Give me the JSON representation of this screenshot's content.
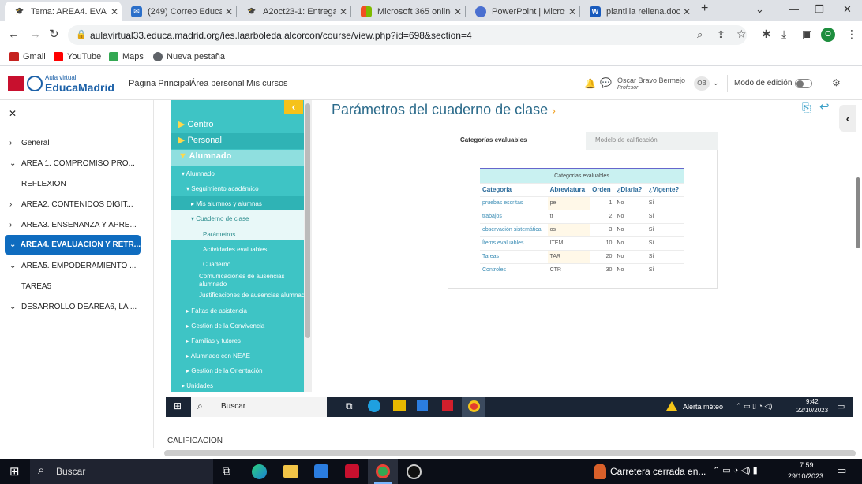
{
  "browser": {
    "tabs": [
      {
        "title": "Tema: AREA4. EVALU",
        "icon": "mortarboard-icon",
        "color": "#1a56b0",
        "active": true
      },
      {
        "title": "(249) Correo EducaM",
        "icon": "mail-icon",
        "color": "#2b6fc9"
      },
      {
        "title": "A2oct23-1: Entrega T",
        "icon": "mortarboard-icon",
        "color": "#1a56b0"
      },
      {
        "title": "Microsoft 365 online",
        "icon": "microsoft-icon",
        "color": "#f25022"
      },
      {
        "title": "PowerPoint | Microso",
        "icon": "onedrive-icon",
        "color": "#4a6fd0"
      },
      {
        "title": "plantilla rellena.docx",
        "icon": "word-icon",
        "color": "#185abd"
      }
    ],
    "url": "aulavirtual33.educa.madrid.org/ies.laarboleda.alcorcon/course/view.php?id=698&section=4",
    "profile_initial": "O",
    "bookmarks": [
      {
        "label": "Gmail",
        "color": "#c5221f"
      },
      {
        "label": "YouTube",
        "color": "#ff0000"
      },
      {
        "label": "Maps",
        "color": "#34a853"
      },
      {
        "label": "Nueva pestaña",
        "color": "#5f6368"
      }
    ]
  },
  "site": {
    "logo_small": "Aula virtual",
    "logo_big": "EducaMadrid",
    "nav": [
      "Página Principal",
      "Área personal",
      "Mis cursos"
    ],
    "user_name": "Oscar Bravo Bermejo",
    "user_role": "Profesor",
    "user_initials": "OB",
    "edit_mode_label": "Modo de edición"
  },
  "drawer": {
    "items": [
      {
        "label": "General",
        "chevron": "›"
      },
      {
        "label": "AREA 1. COMPROMISO PRO...",
        "chevron": "⌄"
      },
      {
        "label": "REFLEXION",
        "chevron": ""
      },
      {
        "label": "AREA2. CONTENIDOS DIGIT...",
        "chevron": "›"
      },
      {
        "label": "AREA3. ENSENANZA Y APRE...",
        "chevron": "›"
      },
      {
        "label": "AREA4. EVALUACION Y RETR...",
        "chevron": "⌄",
        "active": true
      },
      {
        "label": "AREA5. EMPODERAMIENTO ...",
        "chevron": "⌄"
      },
      {
        "label": "TAREA5",
        "chevron": ""
      },
      {
        "label": "DESARROLLO DEAREA6, LA ...",
        "chevron": "⌄"
      }
    ]
  },
  "inner": {
    "menu": [
      {
        "label": "Centro",
        "big": true
      },
      {
        "label": "Personal",
        "big": true
      },
      {
        "label": "Alumnado",
        "big": true
      },
      {
        "label": "Alumnado"
      },
      {
        "label": "Seguimiento académico"
      },
      {
        "label": "Mis alumnos y alumnas"
      },
      {
        "label": "Cuaderno de clase"
      },
      {
        "label": "Parámetros"
      },
      {
        "label": "Actividades evaluables"
      },
      {
        "label": "Cuaderno"
      },
      {
        "label": "Comunicaciones de ausencias"
      },
      {
        "label": "alumnado"
      },
      {
        "label": "Justificaciones de ausencias alumnado"
      },
      {
        "label": "Faltas de asistencia"
      },
      {
        "label": "Gestión de la Convivencia"
      },
      {
        "label": "Familias y tutores"
      },
      {
        "label": "Alumnado con NEAE"
      },
      {
        "label": "Gestión de la Orientación"
      },
      {
        "label": "Unidades"
      }
    ],
    "page_title": "Parámetros del cuaderno de clase",
    "tabs": [
      "Categorías evaluables",
      "Modelo de calificación"
    ],
    "table_caption": "Categorías evaluables",
    "columns": [
      "Categoría",
      "Abreviatura",
      "Orden",
      "¿Diaria?",
      "¿Vigente?"
    ],
    "rows": [
      [
        "pruebas escritas",
        "pe",
        "1",
        "No",
        "Sí"
      ],
      [
        "trabajos",
        "tr",
        "2",
        "No",
        "Sí"
      ],
      [
        "observación sistemática",
        "os",
        "3",
        "No",
        "Sí"
      ],
      [
        "Ítems evaluables",
        "ITEM",
        "10",
        "No",
        "Sí"
      ],
      [
        "Tareas",
        "TAR",
        "20",
        "No",
        "Sí"
      ],
      [
        "Controles",
        "CTR",
        "30",
        "No",
        "Sí"
      ]
    ],
    "taskbar": {
      "search": "Buscar",
      "weather": "Alerta méteo",
      "time": "9:42",
      "date": "22/10/2023"
    }
  },
  "footer_label": "CALIFICACION",
  "taskbar": {
    "search": "Buscar",
    "news": "Carretera cerrada en...",
    "time": "7:59",
    "date": "29/10/2023"
  }
}
